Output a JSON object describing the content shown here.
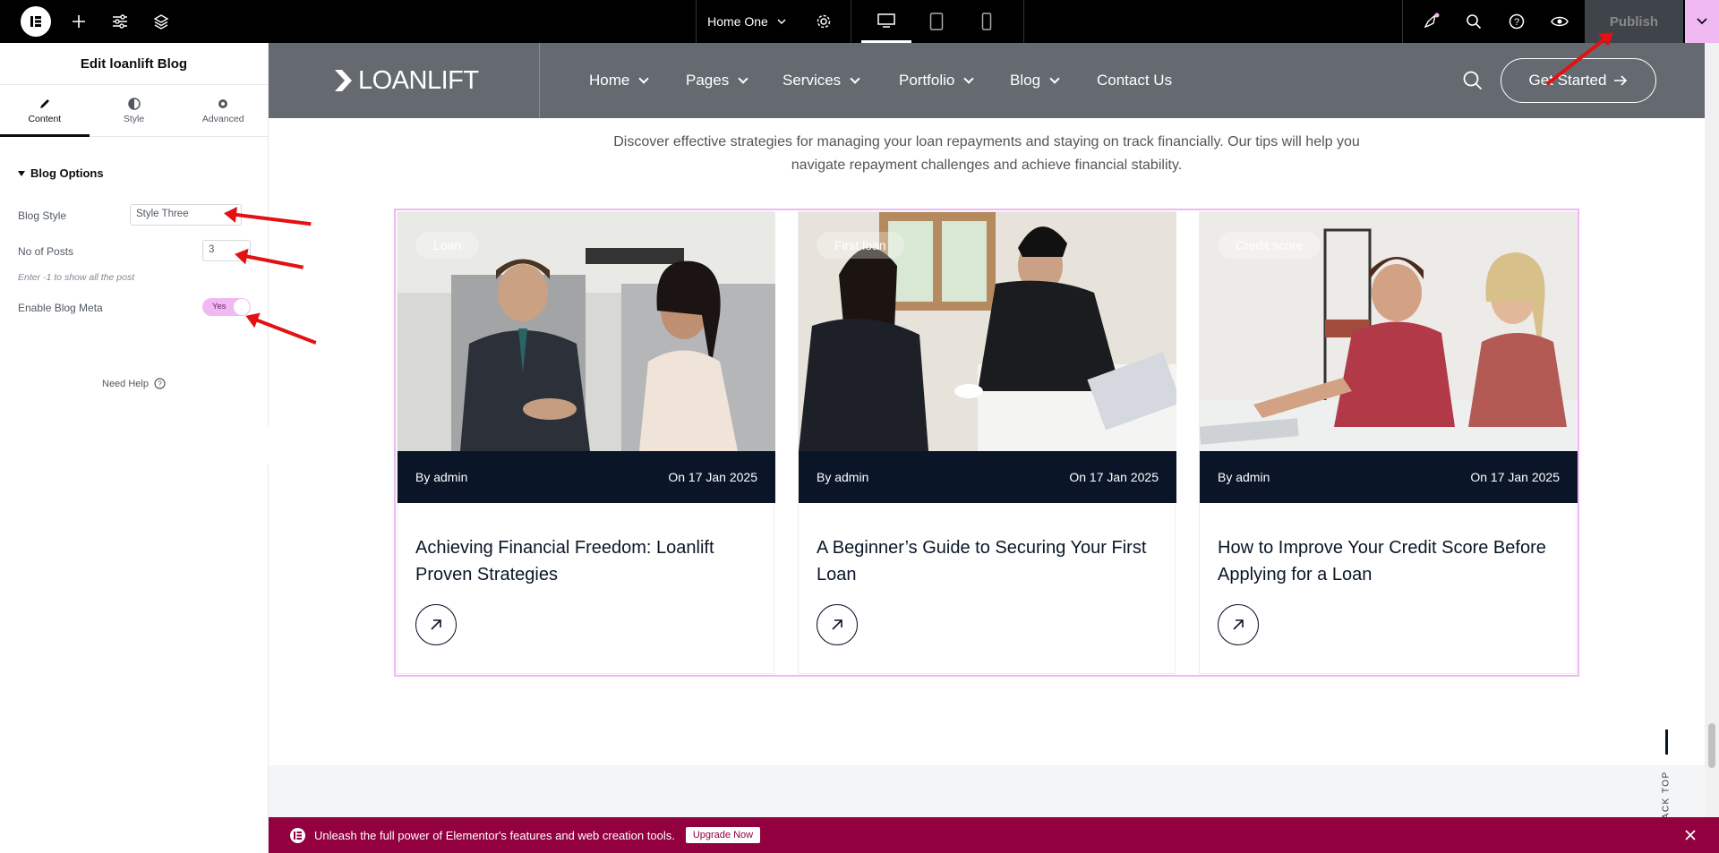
{
  "topbar": {
    "page_name": "Home One",
    "publish_label": "Publish"
  },
  "panel": {
    "title": "Edit loanlift Blog",
    "tabs": [
      {
        "label": "Content"
      },
      {
        "label": "Style"
      },
      {
        "label": "Advanced"
      }
    ],
    "section_title": "Blog Options",
    "blog_style_label": "Blog Style",
    "blog_style_value": "Style Three",
    "posts_label": "No of Posts",
    "posts_value": "3",
    "posts_hint": "Enter -1 to show all the post",
    "meta_label": "Enable Blog Meta",
    "meta_toggle": "Yes",
    "need_help": "Need Help"
  },
  "site": {
    "logo": "LOANLIFT",
    "nav": [
      "Home",
      "Pages",
      "Services",
      "Portfolio",
      "Blog",
      "Contact Us"
    ],
    "cta": "Get Started",
    "intro_line1": "Discover effective strategies for managing your loan repayments and staying on track financially. Our tips will help you",
    "intro_line2": "navigate repayment challenges and achieve financial stability.",
    "back_top": "BACK TOP"
  },
  "posts": [
    {
      "tag": "Loan",
      "author": "By admin",
      "date": "On 17 Jan 2025",
      "title": "Achieving Financial Freedom: Loanlift Proven Strategies"
    },
    {
      "tag": "First loan",
      "author": "By admin",
      "date": "On 17 Jan 2025",
      "title": "A Beginner’s Guide to Securing Your First Loan"
    },
    {
      "tag": "Credit score",
      "author": "By admin",
      "date": "On 17 Jan 2025",
      "title": "How to Improve Your Credit Score Before Applying for a Loan"
    }
  ],
  "banner": {
    "text": "Unleash the full power of Elementor's features and web creation tools.",
    "button": "Upgrade Now"
  },
  "colors": {
    "accent_pink": "#f0b9f2",
    "banner": "#93003f",
    "meta_bar": "#0a1628",
    "annotation_arrow": "#e21212"
  }
}
